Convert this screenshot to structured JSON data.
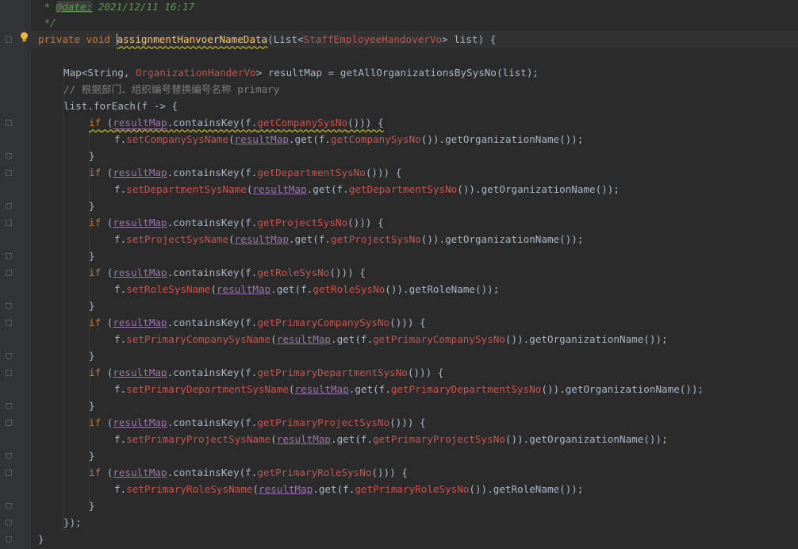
{
  "code": {
    "doc_date_prefix": " * ",
    "doc_date_tag": "@date:",
    "doc_date_value": " 2021/12/11 16:17",
    "doc_end": " */",
    "method_sig": {
      "modifiers": "private void ",
      "name": "assignmentHanvoerNameData",
      "params_open": "(List<",
      "param_type": "StaffEmployeeHandoverVo",
      "params_close": "> list) {"
    },
    "map_line": {
      "p1": "Map<String, ",
      "type": "OrganizationHanderVo",
      "p2": "> resultMap = getAllOrganizationsBySysNo(list);"
    },
    "comment_cn": "// 根据部门、组织编号替换编号名称 primary",
    "foreach_line": "list.forEach(f -> {",
    "blocks": [
      {
        "getter": "getCompanySysNo",
        "setter": "setCompanySysName",
        "tail": "getOrganizationName"
      },
      {
        "getter": "getDepartmentSysNo",
        "setter": "setDepartmentSysName",
        "tail": "getOrganizationName"
      },
      {
        "getter": "getProjectSysNo",
        "setter": "setProjectSysName",
        "tail": "getOrganizationName"
      },
      {
        "getter": "getRoleSysNo",
        "setter": "setRoleSysName",
        "tail": "getRoleName"
      },
      {
        "getter": "getPrimaryCompanySysNo",
        "setter": "setPrimaryCompanySysName",
        "tail": "getOrganizationName"
      },
      {
        "getter": "getPrimaryDepartmentSysNo",
        "setter": "setPrimaryDepartmentSysName",
        "tail": "getOrganizationName"
      },
      {
        "getter": "getPrimaryProjectSysNo",
        "setter": "setPrimaryProjectSysName",
        "tail": "getOrganizationName"
      },
      {
        "getter": "getPrimaryRoleSysNo",
        "setter": "setPrimaryRoleSysName",
        "tail": "getRoleName"
      }
    ],
    "tokens": {
      "if": "if",
      "result_map": "resultMap",
      "contains": ".containsKey(f.",
      "close_if": "())) {",
      "f_dot": "f.",
      "get": ".get(f.",
      "tail_open": "()).",
      "tail_close": "());",
      "open_paren": "(",
      "space_paren": " (",
      "close_brace": "}"
    },
    "foreach_end": "});",
    "method_end": "}"
  }
}
